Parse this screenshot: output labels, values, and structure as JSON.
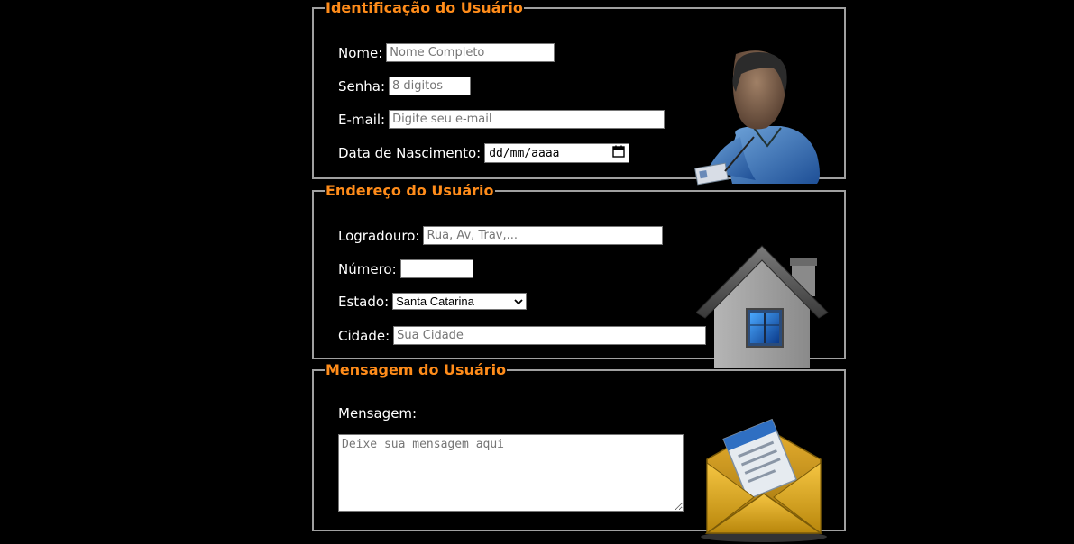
{
  "user_section": {
    "legend": "Identificação do Usuário",
    "name_label": "Nome:",
    "name_placeholder": "Nome Completo",
    "password_label": "Senha:",
    "password_placeholder": "8 digitos",
    "email_label": "E-mail:",
    "email_placeholder": "Digite seu e-mail",
    "birth_label": "Data de Nascimento:",
    "birth_placeholder": "dd/mm/aaaa"
  },
  "address_section": {
    "legend": "Endereço do Usuário",
    "street_label": "Logradouro:",
    "street_placeholder": "Rua, Av, Trav,...",
    "number_label": "Número:",
    "state_label": "Estado:",
    "state_selected": "Santa Catarina",
    "city_label": "Cidade:",
    "city_placeholder": "Sua Cidade"
  },
  "message_section": {
    "legend": "Mensagem do Usuário",
    "message_label": "Mensagem:",
    "message_placeholder": "Deixe sua mensagem aqui"
  },
  "icons": {
    "user": "user-avatar-icon",
    "house": "house-icon",
    "envelope": "envelope-icon",
    "calendar": "calendar-icon",
    "dropdown": "chevron-down-icon"
  },
  "colors": {
    "legend": "#ff8c1a",
    "background": "#000000",
    "border": "#a0a0a0"
  }
}
